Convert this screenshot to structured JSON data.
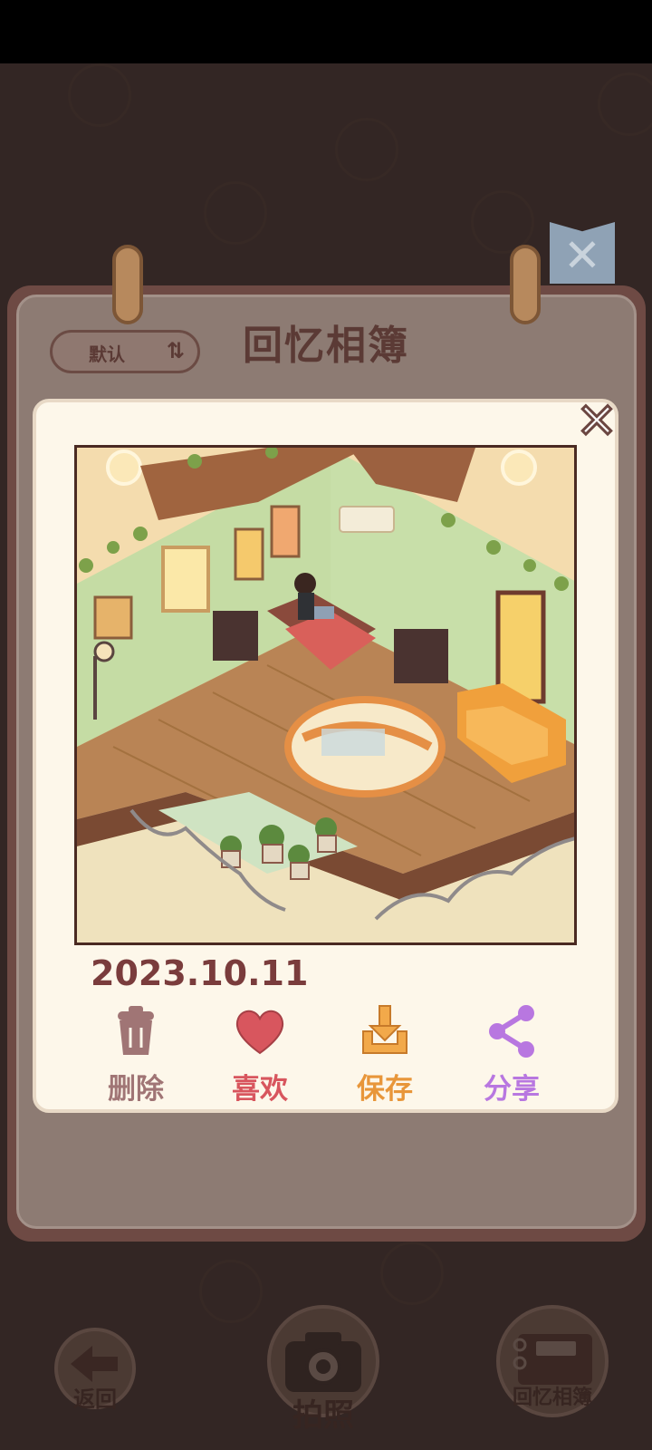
{
  "album": {
    "title": "回忆相簿",
    "sort_label": "默认",
    "sort_icon": "sort-arrows-icon"
  },
  "photo": {
    "date": "2023.10.11",
    "actions": [
      {
        "name": "delete",
        "label": "删除",
        "icon": "trash-icon",
        "color": "#a07575"
      },
      {
        "name": "like",
        "label": "喜欢",
        "icon": "heart-icon",
        "color": "#d8565e"
      },
      {
        "name": "save",
        "label": "保存",
        "icon": "download-icon",
        "color": "#e8963a"
      },
      {
        "name": "share",
        "label": "分享",
        "icon": "share-icon",
        "color": "#b877e0"
      }
    ]
  },
  "nav": {
    "back_label": "返回",
    "camera_label": "拍照",
    "album_label": "回忆相簿"
  },
  "colors": {
    "board": "#6e4a44",
    "modal": "#fdf7ea",
    "date": "#7a3c3c"
  }
}
